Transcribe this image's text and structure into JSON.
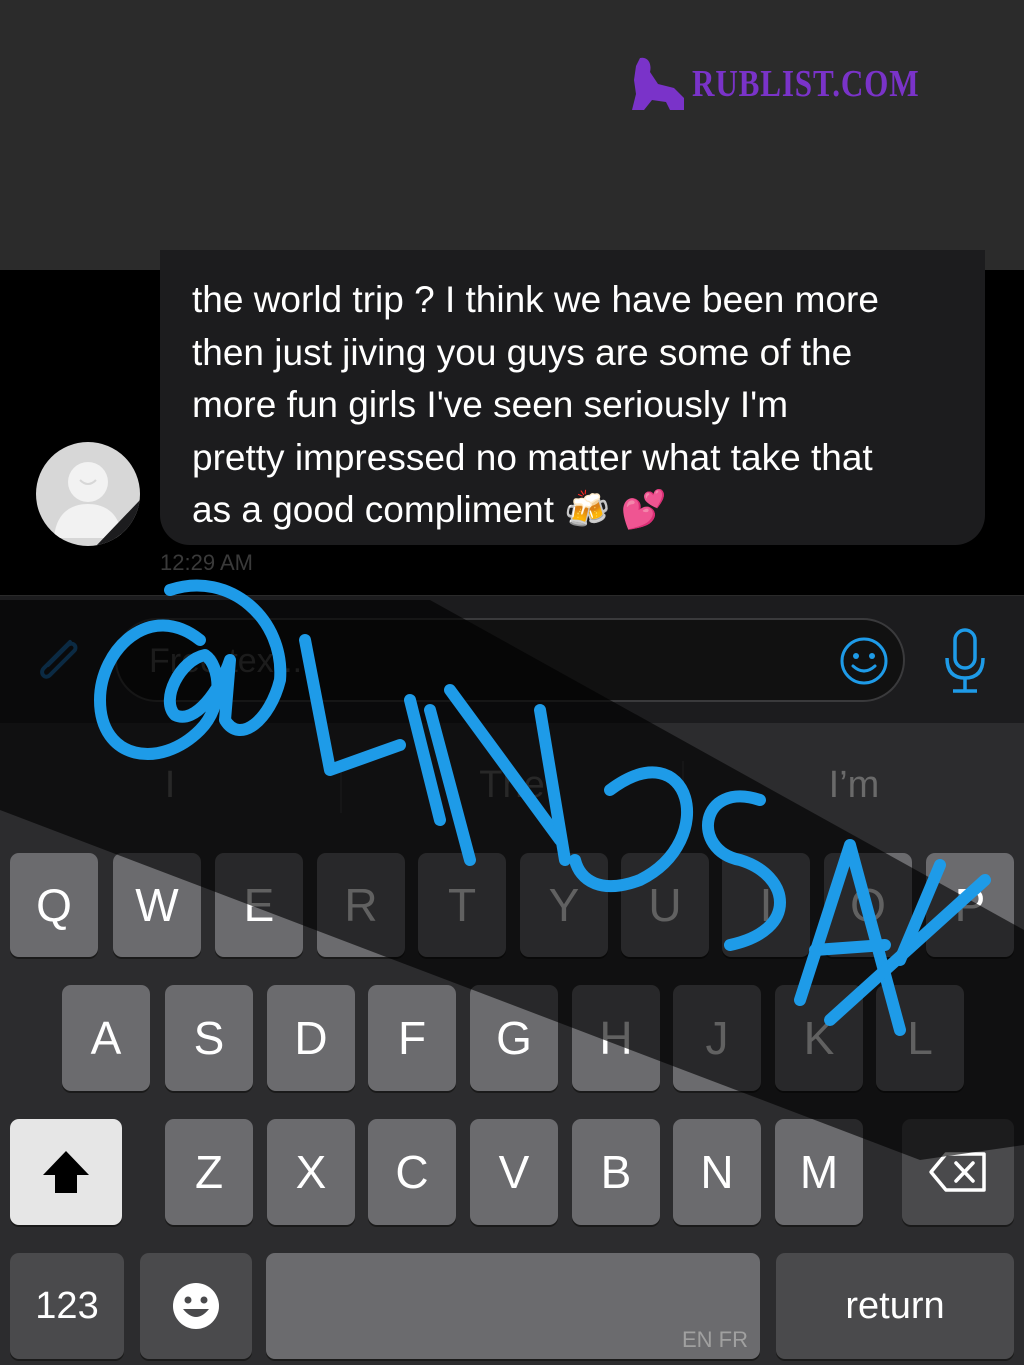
{
  "watermark": {
    "text": "RUBLIST.COM"
  },
  "message": {
    "text": "the world trip ? I think we have been more\nthen just jiving you guys are some of the\nmore fun girls I've seen seriously I'm\npretty impressed no matter what take that\nas a good compliment 🍻 💕",
    "timestamp": "12:29 AM"
  },
  "composer": {
    "placeholder": "Free text..."
  },
  "suggestions": [
    "I",
    "The",
    "I’m"
  ],
  "keyboard": {
    "row1": [
      "Q",
      "W",
      "E",
      "R",
      "T",
      "Y",
      "U",
      "I",
      "O",
      "P"
    ],
    "row2": [
      "A",
      "S",
      "D",
      "F",
      "G",
      "H",
      "J",
      "K",
      "L"
    ],
    "row3": [
      "Z",
      "X",
      "C",
      "V",
      "B",
      "N",
      "M"
    ],
    "numbers_label": "123",
    "return_label": "return",
    "space_languages": "EN FR"
  },
  "overlay": {
    "text": "@LINDSAY",
    "color": "#1e9be8"
  },
  "colors": {
    "brand": "#7a33c9",
    "accent": "#1e9be8"
  }
}
